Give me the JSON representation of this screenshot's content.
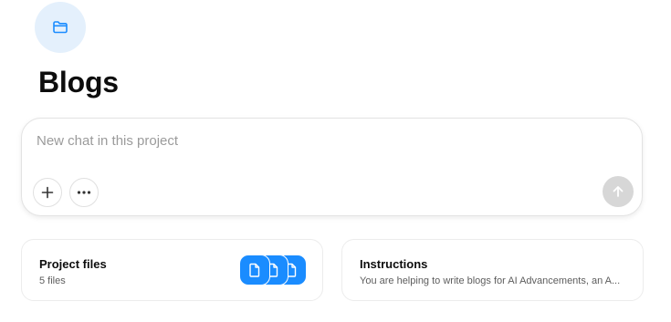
{
  "project": {
    "icon": "folder-icon",
    "title": "Blogs"
  },
  "composer": {
    "placeholder": "New chat in this project",
    "add_icon": "plus-icon",
    "more_icon": "more-horizontal-icon",
    "send_icon": "arrow-up-icon"
  },
  "files_card": {
    "title": "Project files",
    "subtitle": "5 files",
    "file_icon": "file-icon"
  },
  "instructions_card": {
    "title": "Instructions",
    "preview": "You are helping to write blogs for AI Advancements, an A..."
  },
  "colors": {
    "accent": "#1a8cff",
    "icon_bg": "#e4f0fc",
    "send_disabled": "#d7d7d7"
  }
}
